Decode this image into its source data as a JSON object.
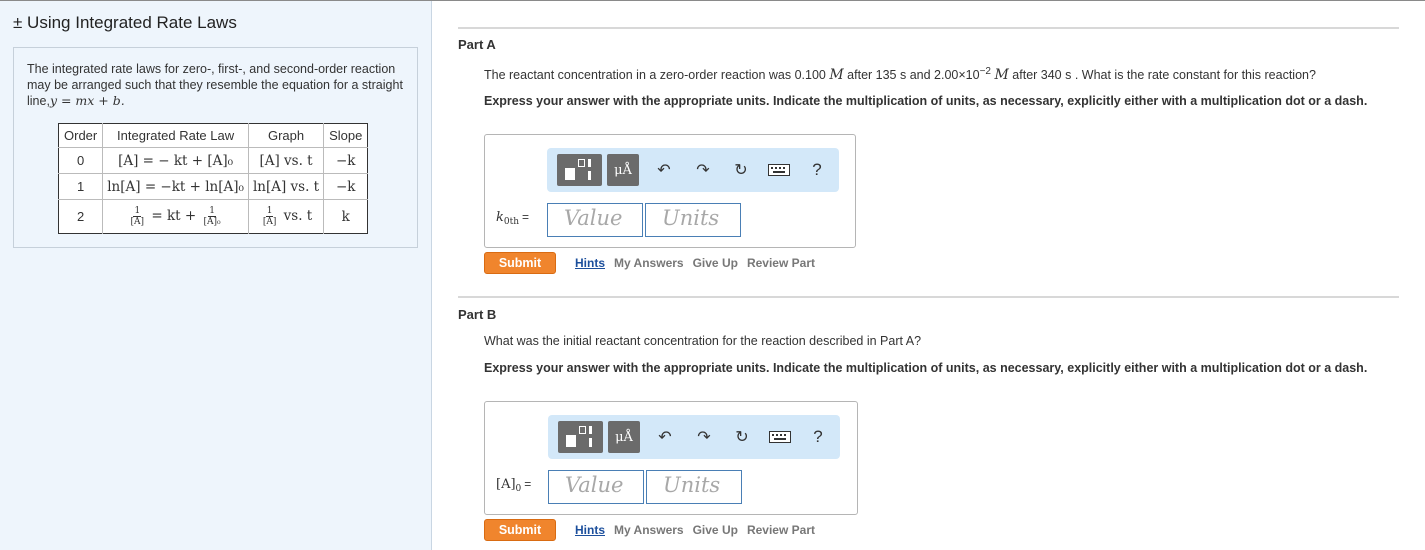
{
  "left": {
    "title": "± Using Integrated Rate Laws",
    "intro_text": "The integrated rate laws for zero-, first-, and second-order reaction may be arranged such that they resemble the equation for a straight line,",
    "intro_equation": "y = mx + b.",
    "table": {
      "headers": [
        "Order",
        "Integrated Rate Law",
        "Graph",
        "Slope"
      ],
      "rows": [
        {
          "order": "0",
          "law": "[A] = − kt + [A]₀",
          "graph": "[A] vs. t",
          "slope": "−k"
        },
        {
          "order": "1",
          "law": "ln[A] = −kt + ln[A]₀",
          "graph": "ln[A] vs. t",
          "slope": "−k"
        },
        {
          "order": "2",
          "law_mid": "= kt +",
          "frac_num": "1",
          "frac_den_a": "[A]",
          "frac_den_b": "[A]₀",
          "graph_tail": "vs. t",
          "slope": "k"
        }
      ]
    }
  },
  "part_a": {
    "label": "Part A",
    "question_pre": "The reactant concentration in a zero-order reaction was 0.100",
    "unit_m": "M",
    "question_mid": "after 135 s and 2.00×10",
    "exp": "−2",
    "question_post": "after 340 s . What is the rate constant for this reaction?",
    "instruction": "Express your answer with the appropriate units. Indicate the multiplication of units, as necessary, explicitly either with a multiplication dot or a dash.",
    "answer_var": "k",
    "answer_sub": "0th",
    "equals": "=",
    "value_placeholder": "Value",
    "units_placeholder": "Units",
    "submit": "Submit",
    "links": {
      "hints": "Hints",
      "my_answers": "My Answers",
      "give_up": "Give Up",
      "review": "Review Part"
    }
  },
  "part_b": {
    "label": "Part B",
    "question": "What was the initial reactant concentration for the reaction described in Part A?",
    "instruction": "Express your answer with the appropriate units. Indicate the multiplication of units, as necessary, explicitly either with a multiplication dot or a dash.",
    "answer_var": "[A]",
    "answer_sub": "0",
    "equals": "=",
    "value_placeholder": "Value",
    "units_placeholder": "Units",
    "submit": "Submit",
    "links": {
      "hints": "Hints",
      "my_answers": "My Answers",
      "give_up": "Give Up",
      "review": "Review Part"
    }
  },
  "toolbar": {
    "mu_label": "μÅ",
    "undo": "↶",
    "redo": "↷",
    "reset": "↻",
    "help": "?",
    "icons": [
      "templates-icon",
      "units-icon",
      "undo-icon",
      "redo-icon",
      "reset-icon",
      "keyboard-icon",
      "help-icon"
    ]
  }
}
